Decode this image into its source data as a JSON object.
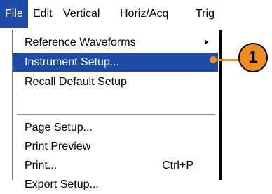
{
  "menubar": {
    "items": [
      {
        "label": "File",
        "active": true
      },
      {
        "label": "Edit"
      },
      {
        "label": "Vertical"
      },
      {
        "label": "Horiz/Acq"
      },
      {
        "label": "Trig"
      }
    ]
  },
  "file_menu": {
    "items": [
      {
        "label": "Reference Waveforms",
        "submenu": true
      },
      {
        "label": "Instrument Setup...",
        "highlighted": true
      },
      {
        "label": "Recall Default Setup"
      },
      {
        "label": "Page Setup..."
      },
      {
        "label": "Print Preview"
      },
      {
        "label": "Print...",
        "shortcut": "Ctrl+P"
      },
      {
        "label": "Export Setup..."
      }
    ]
  },
  "callout": {
    "number": "1",
    "color": "#f08c1e"
  },
  "colors": {
    "highlight": "#1e4ba8"
  }
}
